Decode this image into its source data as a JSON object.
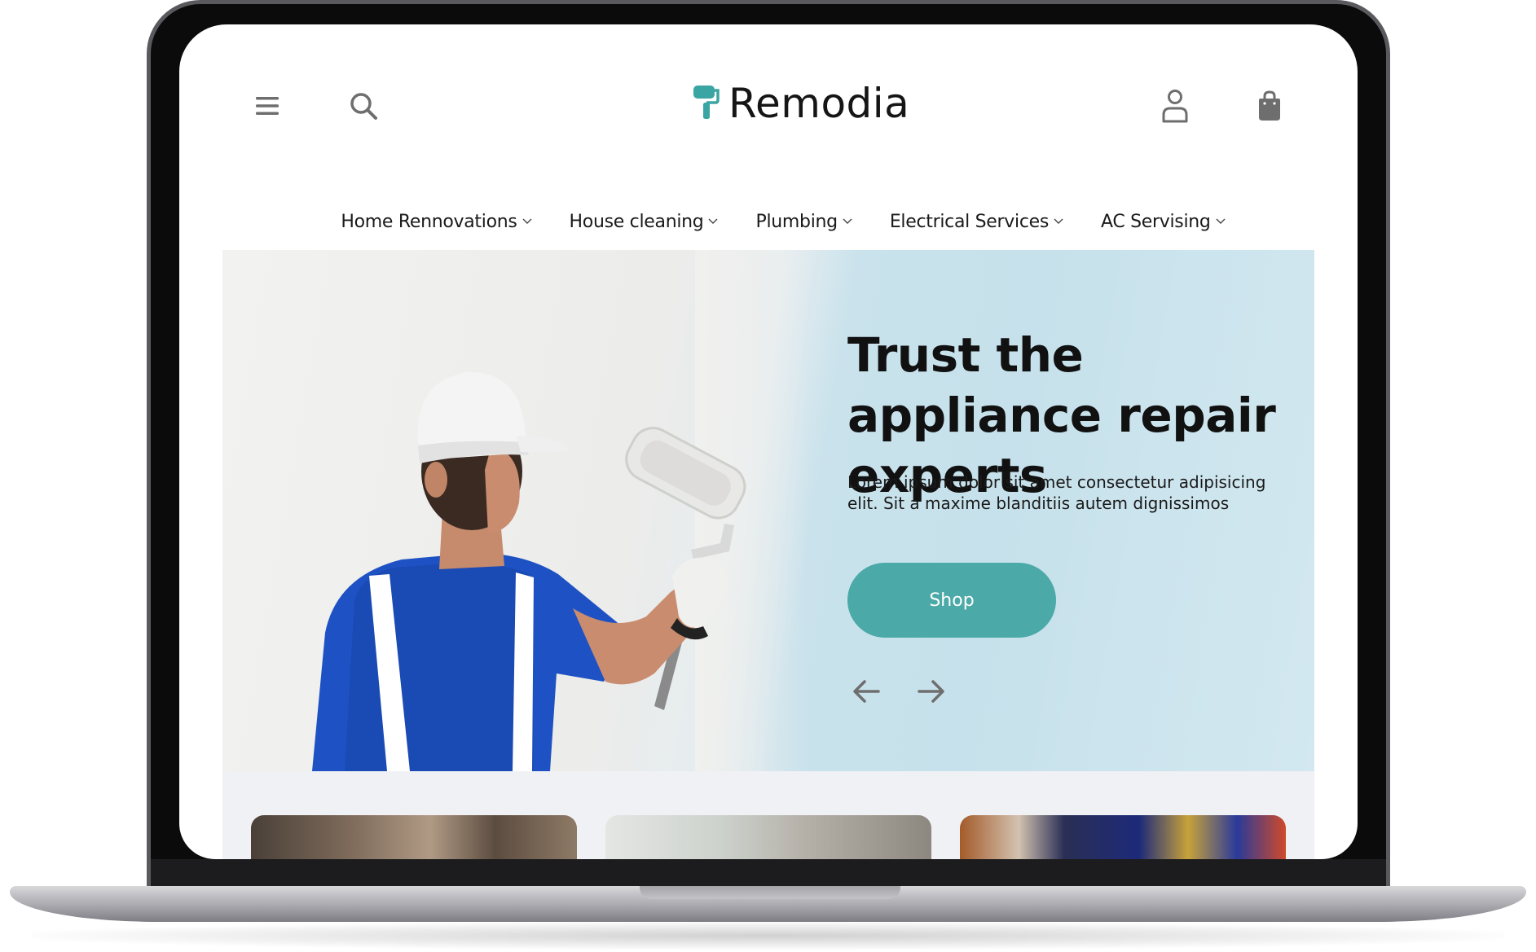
{
  "brand": {
    "name": "Remodia",
    "accent_color": "#4ba9a8"
  },
  "header": {
    "menu_icon": "hamburger-menu-icon",
    "search_icon": "search-icon",
    "account_icon": "user-icon",
    "cart_icon": "shopping-bag-icon"
  },
  "nav": {
    "items": [
      {
        "label": "Home Rennovations"
      },
      {
        "label": "House cleaning"
      },
      {
        "label": "Plumbing"
      },
      {
        "label": "Electrical Services"
      },
      {
        "label": "AC Servising"
      }
    ]
  },
  "hero": {
    "title": "Trust the appliance repair experts",
    "description": "Lorem ipsum dolor sit amet consectetur adipisicing elit. Sit a maxime blanditiis autem dignissimos",
    "button_label": "Shop",
    "prev_icon": "arrow-left-icon",
    "next_icon": "arrow-right-icon"
  }
}
